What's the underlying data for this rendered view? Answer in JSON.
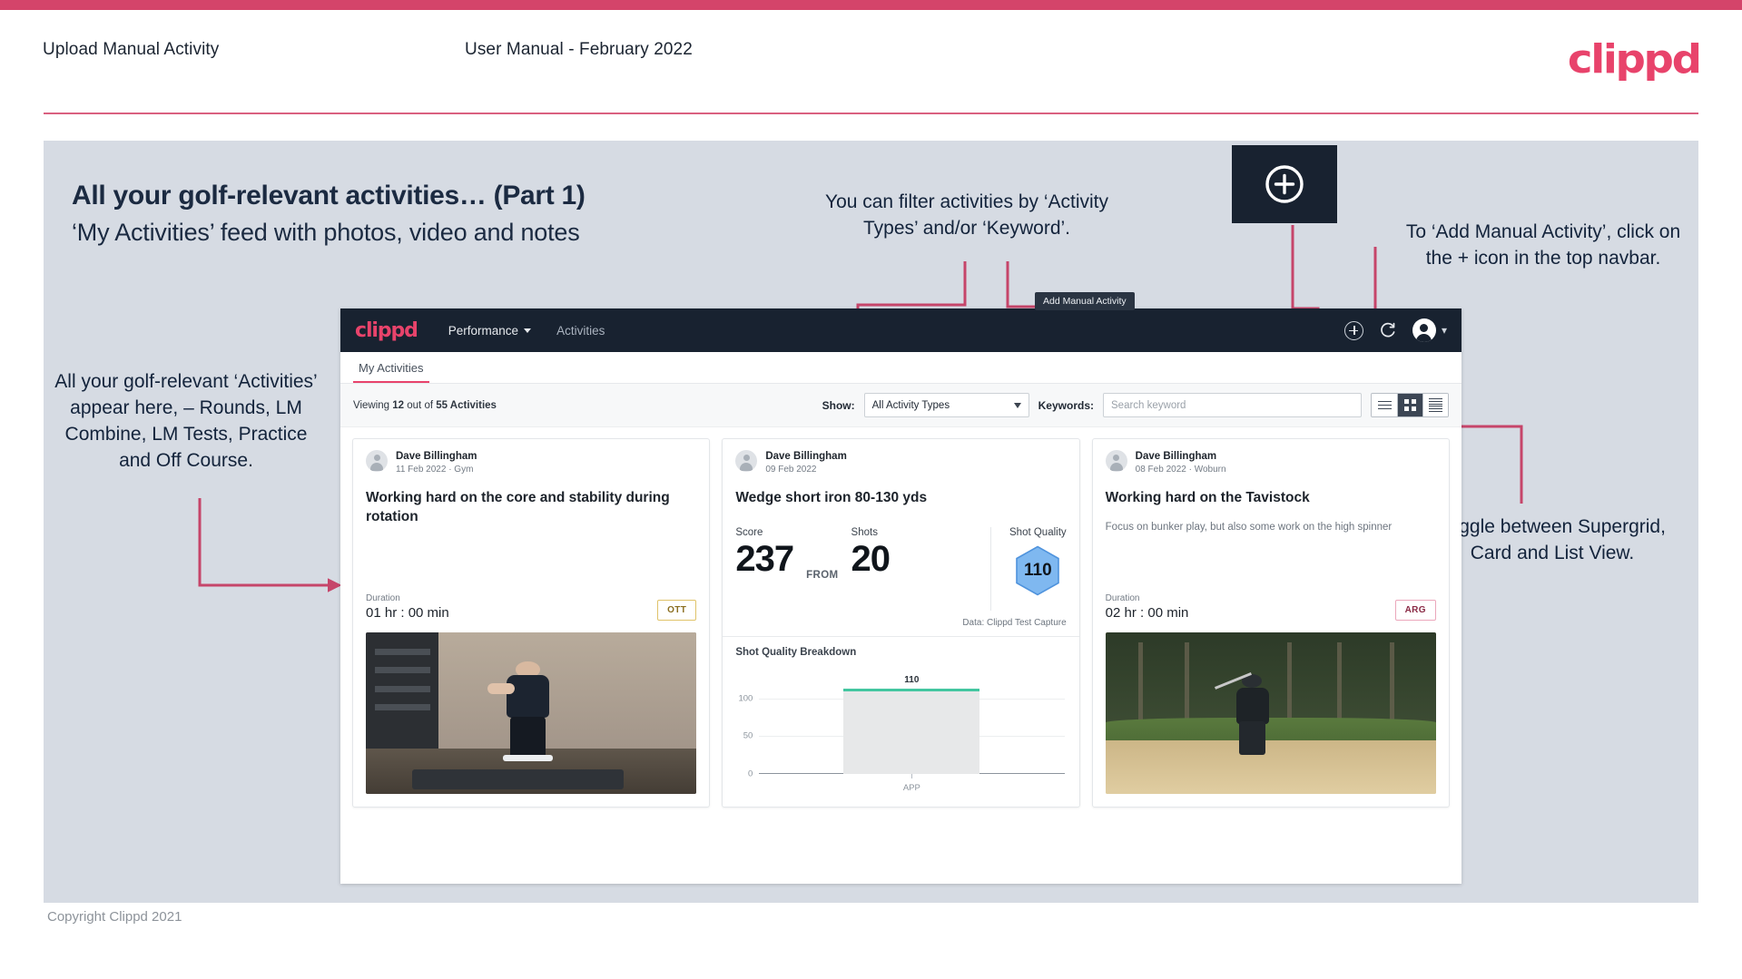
{
  "header": {
    "left_title": "Upload Manual Activity",
    "center_title": "User Manual - February 2022",
    "logo": "clippd"
  },
  "headline": {
    "line1": "All your golf-relevant activities… (Part 1)",
    "line2": "‘My Activities’ feed with photos, video and notes"
  },
  "annotations": {
    "filter": "You can filter activities by ‘Activity Types’ and/or ‘Keyword’.",
    "add_manual": "To ‘Add Manual Activity’, click on the + icon in the top navbar.",
    "feed": "All your golf-relevant ‘Activities’ appear here, – Rounds, LM Combine, LM Tests, Practice and Off Course.",
    "toggle": "Toggle between Supergrid, Card and List View."
  },
  "plus_callout": {
    "icon": "plus-circle-icon"
  },
  "app": {
    "navbar": {
      "logo": "clippd",
      "links": [
        {
          "label": "Performance",
          "has_chevron": true
        },
        {
          "label": "Activities",
          "has_chevron": false
        }
      ],
      "icons": [
        "add-circle-icon",
        "refresh-icon",
        "user-avatar-icon",
        "chevron-down-icon"
      ],
      "tooltip": "Add Manual Activity"
    },
    "tabs": [
      {
        "label": "My Activities",
        "active": true
      }
    ],
    "filterbar": {
      "viewing_prefix": "Viewing ",
      "viewing_count": "12",
      "viewing_middle": " out of ",
      "viewing_total": "55 Activities",
      "show_label": "Show:",
      "activity_type_value": "All Activity Types",
      "keywords_label": "Keywords:",
      "keyword_placeholder": "Search keyword",
      "view_modes": [
        "list-view-icon",
        "supergrid-view-icon",
        "card-view-icon"
      ],
      "active_view": "supergrid-view-icon"
    },
    "cards": [
      {
        "user": "Dave Billingham",
        "meta": "11 Feb 2022 · Gym",
        "title": "Working hard on the core and stability during rotation",
        "note": "",
        "duration_label": "Duration",
        "duration_value": "01 hr : 00 min",
        "tag": "OTT",
        "tag_color": "#e0c36a",
        "media": "gym-video-thumbnail"
      },
      {
        "user": "Dave Billingham",
        "meta": "09 Feb 2022",
        "title": "Wedge short iron 80-130 yds",
        "stats": {
          "score_label": "Score",
          "score_value": "237",
          "from_label": "FROM",
          "shots_label": "Shots",
          "shots_value": "20",
          "shot_quality_label": "Shot Quality",
          "shot_quality_value": "110"
        },
        "data_source": "Data: Clippd Test Capture",
        "breakdown_title": "Shot Quality Breakdown"
      },
      {
        "user": "Dave Billingham",
        "meta": "08 Feb 2022 · Woburn",
        "title": "Working hard on the Tavistock",
        "note": "Focus on bunker play, but also some work on the high spinner",
        "duration_label": "Duration",
        "duration_value": "02 hr : 00 min",
        "tag": "ARG",
        "tag_color": "#eba7bb",
        "media": "golf-bunker-photo"
      }
    ]
  },
  "chart_data": {
    "type": "bar",
    "title": "Shot Quality Breakdown",
    "categories": [
      "APP"
    ],
    "values": [
      110
    ],
    "data_labels": [
      "110"
    ],
    "ylabel": "",
    "xlabel": "",
    "ylim": [
      0,
      125
    ],
    "yticks": [
      0,
      50,
      100
    ],
    "ytick_labels": [
      "0",
      "50",
      "100"
    ],
    "grid": true,
    "legend": false,
    "bar_fill": "#e7e8e9",
    "bar_cap_color": "#43c6a0"
  },
  "footer": {
    "copyright": "Copyright Clippd 2021"
  },
  "colors": {
    "accent_pink": "#d4446a",
    "brand_pink": "#e8436b",
    "panel_bg": "#d6dbe3",
    "navy": "#182230"
  }
}
